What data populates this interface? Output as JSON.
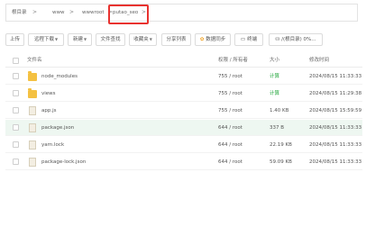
{
  "breadcrumb": {
    "items": [
      "根目录",
      "www",
      "wwwroot",
      "putao_seo"
    ],
    "separator": ">"
  },
  "toolbar": {
    "buttons": [
      {
        "label": "上传",
        "has_caret": false
      },
      {
        "label": "远程下载",
        "has_caret": true
      },
      {
        "label": "新建",
        "has_caret": true
      },
      {
        "label": "文件查找",
        "has_caret": false
      },
      {
        "label": "收藏夹",
        "has_caret": true
      },
      {
        "label": "分享列表",
        "has_caret": false
      },
      {
        "label": "数据同步",
        "has_caret": false
      },
      {
        "label": "终端",
        "has_caret": false
      },
      {
        "label": "/(根目录) 0%...",
        "has_caret": false
      }
    ]
  },
  "table": {
    "headers": {
      "name": "文件名",
      "perm": "权限 / 所有者",
      "size": "大小",
      "mtime": "修改时间"
    },
    "rows": [
      {
        "name": "node_modules",
        "type": "folder",
        "perm": "755 / root",
        "size": "计算",
        "mtime": "2024/08/15 11:33:33",
        "highlight": false
      },
      {
        "name": "views",
        "type": "folder",
        "perm": "755 / root",
        "size": "计算",
        "mtime": "2024/08/15 11:29:38",
        "highlight": false
      },
      {
        "name": "app.js",
        "type": "file",
        "perm": "755 / root",
        "size": "1.40 KB",
        "mtime": "2024/08/15 15:59:59",
        "highlight": false
      },
      {
        "name": "package.json",
        "type": "file",
        "perm": "644 / root",
        "size": "337 B",
        "mtime": "2024/08/15 11:33:33",
        "highlight": true
      },
      {
        "name": "yarn.lock",
        "type": "file",
        "perm": "644 / root",
        "size": "22.19 KB",
        "mtime": "2024/08/15 11:33:33",
        "highlight": false
      },
      {
        "name": "package-lock.json",
        "type": "file",
        "perm": "644 / root",
        "size": "59.09 KB",
        "mtime": "2024/08/15 11:33:33",
        "highlight": false
      }
    ]
  },
  "colors": {
    "accent_green": "#20a53a",
    "highlight_red": "#e8322f",
    "row_highlight": "#eef7f1",
    "folder": "#f4c142"
  }
}
